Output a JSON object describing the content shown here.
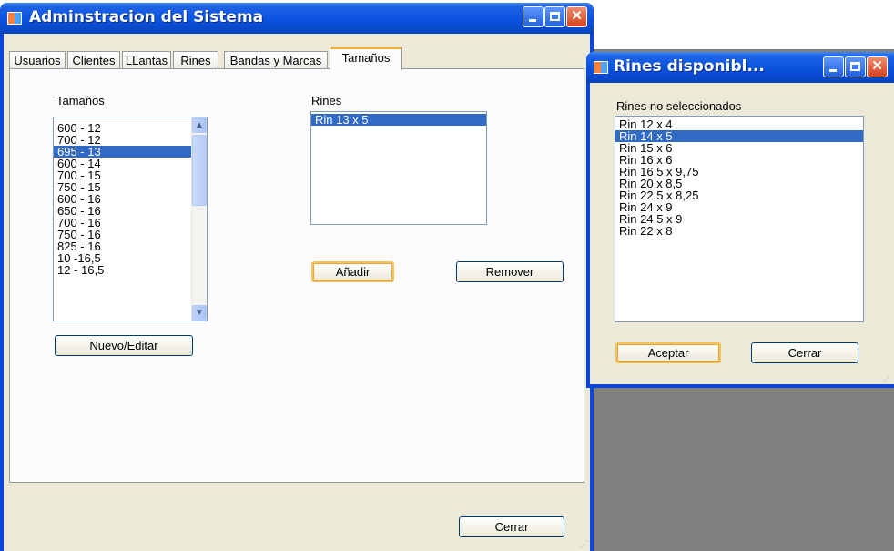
{
  "main_window": {
    "title": "Adminstracion del Sistema",
    "tabs": [
      "Usuarios",
      "Clientes",
      "LLantas",
      "Rines",
      "Bandas y Marcas",
      "Tamaños"
    ],
    "active_tab": "Tamaños",
    "tamanos_label": "Tamaños",
    "tamanos_items": [
      "600 - 12",
      "700 - 12",
      "695 - 13",
      "600 - 14",
      "700 - 15",
      "750 - 15",
      "600 - 16",
      "650 - 16",
      "700 - 16",
      "750 - 16",
      "825 - 16",
      "10 -16,5",
      "12 - 16,5"
    ],
    "tamanos_selected": "695 - 13",
    "rines_label": "Rines",
    "rines_items": [
      "Rin 13 x 5"
    ],
    "rines_selected": "Rin 13 x 5",
    "nuevo_editar_label": "Nuevo/Editar",
    "anadir_label": "Añadir",
    "remover_label": "Remover",
    "cerrar_label": "Cerrar"
  },
  "dialog": {
    "title": "Rines disponibl...",
    "list_label": "Rines no seleccionados",
    "items": [
      "Rin 12 x 4",
      "Rin 14 x 5",
      "Rin 15 x 6",
      "Rin 16 x 6",
      "Rin 16,5 x 9,75",
      "Rin 20 x 8,5",
      "Rin 22,5 x 8,25",
      "Rin 24 x 9",
      "Rin 24,5 x 9",
      "Rin 22 x 8"
    ],
    "selected": "Rin 14 x 5",
    "aceptar_label": "Aceptar",
    "cerrar_label": "Cerrar"
  },
  "colors": {
    "titlebar": "#0a55e0",
    "selection": "#316ac5",
    "window_face": "#ece9d8",
    "desktop": "#808080"
  },
  "icons": {
    "caption": [
      "minimize-icon",
      "maximize-icon",
      "close-icon"
    ],
    "scroll": [
      "chevron-up-icon",
      "chevron-down-icon"
    ]
  }
}
